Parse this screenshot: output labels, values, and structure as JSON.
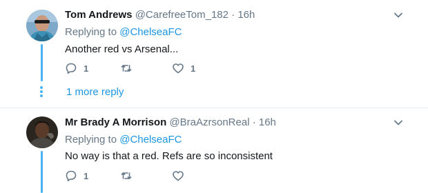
{
  "tweets": [
    {
      "name": "Tom Andrews",
      "handle": "@CarefreeTom_182",
      "separator": "·",
      "time": "16h",
      "replying_prefix": "Replying to",
      "replying_to": "@ChelseaFC",
      "text": "Another red vs Arsenal...",
      "reply_count": "1",
      "retweet_count": "",
      "like_count": "1"
    },
    {
      "name": "Mr Brady A Morrison",
      "handle": "@BraAzrsonReal",
      "separator": "·",
      "time": "16h",
      "replying_prefix": "Replying to",
      "replying_to": "@ChelseaFC",
      "text": "No way is that a red. Refs are so inconsistent",
      "reply_count": "1",
      "retweet_count": "",
      "like_count": ""
    }
  ],
  "more_replies": "1 more reply",
  "icons": {
    "reply": "reply-icon",
    "retweet": "retweet-icon",
    "like": "heart-icon",
    "menu": "chevron-down-icon"
  },
  "colors": {
    "link": "#1b95e0",
    "thread_line": "#4ab3f4",
    "muted": "#657786"
  }
}
